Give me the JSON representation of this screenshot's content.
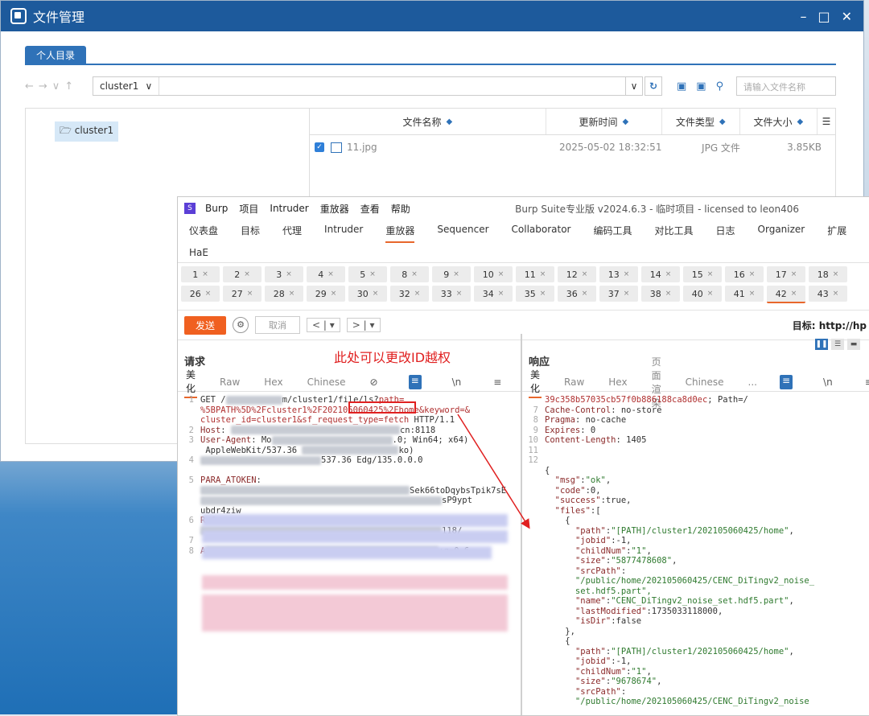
{
  "file_manager": {
    "title": "文件管理",
    "tab": "个人目录",
    "path_select": "cluster1",
    "search_placeholder": "请输入文件名称",
    "tree_root": "cluster1",
    "columns": [
      "文件名称",
      "更新时间",
      "文件类型",
      "文件大小"
    ],
    "files": [
      {
        "name": "11.jpg",
        "time": "2025-05-02 18:32:51",
        "type": "JPG 文件",
        "size": "3.85KB"
      }
    ]
  },
  "burp": {
    "menu": [
      "Burp",
      "项目",
      "Intruder",
      "重放器",
      "查看",
      "帮助"
    ],
    "title": "Burp Suite专业版  v2024.6.3 - 临时项目 - licensed to leon406",
    "tools": [
      "仪表盘",
      "目标",
      "代理",
      "Intruder",
      "重放器",
      "Sequencer",
      "Collaborator",
      "编码工具",
      "对比工具",
      "日志",
      "Organizer",
      "扩展",
      "HaE"
    ],
    "active_tool": "重放器",
    "tabs_row1": [
      "1",
      "2",
      "3",
      "4",
      "5",
      "8",
      "9",
      "10",
      "11",
      "12",
      "13",
      "14",
      "15",
      "16",
      "17",
      "18"
    ],
    "tabs_row2": [
      "26",
      "27",
      "28",
      "29",
      "30",
      "32",
      "33",
      "34",
      "35",
      "36",
      "37",
      "38",
      "40",
      "41",
      "42",
      "43"
    ],
    "active_tab": "42",
    "send_label": "发送",
    "cancel_label": "取消",
    "target_label": "目标: http://hp",
    "request": {
      "title": "请求",
      "subtabs": [
        "美化",
        "Raw",
        "Hex",
        "Chinese"
      ],
      "annotation": "此处可以更改ID越权"
    },
    "response": {
      "title": "响应",
      "subtabs": [
        "美化",
        "Raw",
        "Hex",
        "页面渲染",
        "Chinese",
        "..."
      ]
    }
  }
}
